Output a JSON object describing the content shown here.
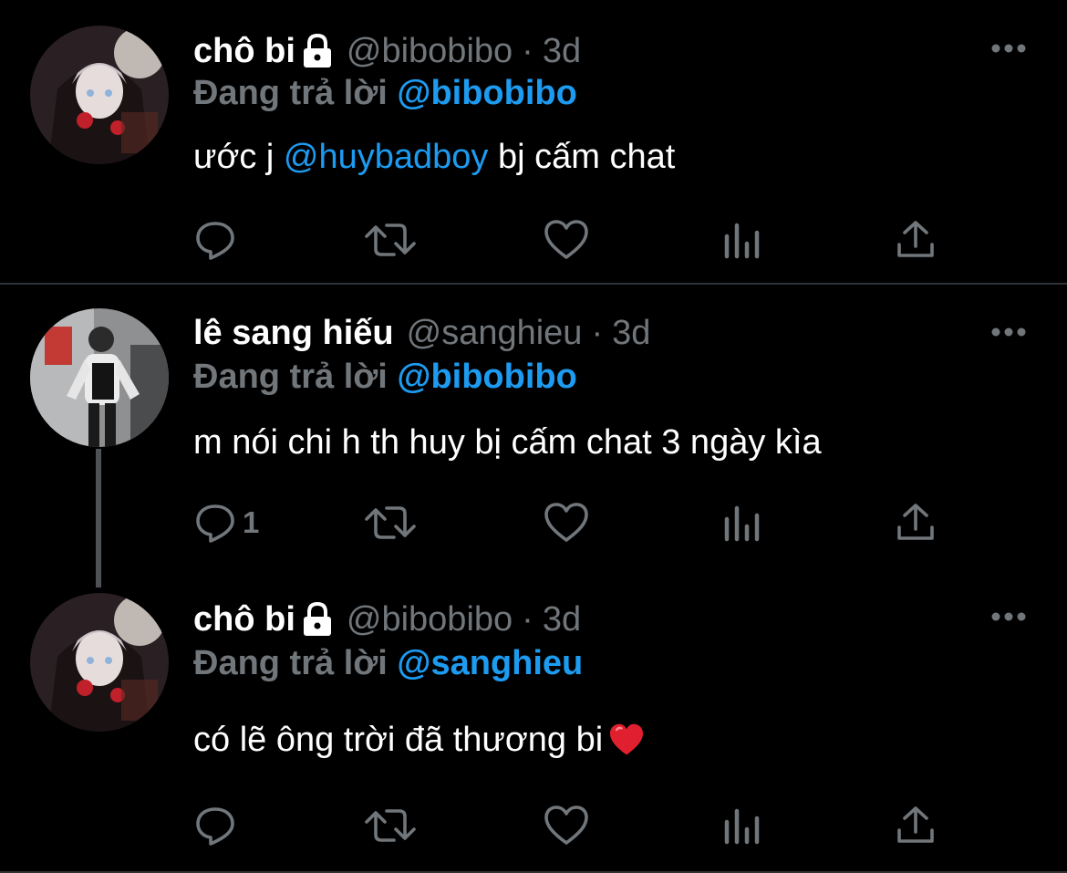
{
  "tweets": [
    {
      "display_name": "chô bi",
      "locked": true,
      "handle": "@bibobibo",
      "separator": "·",
      "time": "3d",
      "reply_prefix": "Đang trả lời",
      "reply_to": "@bibobibo",
      "text_before": "ước j ",
      "mention": "@huybadboy",
      "text_after": " bj cấm chat",
      "reply_count": ""
    },
    {
      "display_name": "lê sang hiếu",
      "locked": false,
      "handle": "@sanghieu",
      "separator": "·",
      "time": "3d",
      "reply_prefix": "Đang trả lời",
      "reply_to": "@bibobibo",
      "text": "m nói chi h th huy bị cấm chat 3 ngày kìa",
      "reply_count": "1"
    },
    {
      "display_name": "chô bi",
      "locked": true,
      "handle": "@bibobibo",
      "separator": "·",
      "time": "3d",
      "reply_prefix": "Đang trả lời",
      "reply_to": "@sanghieu",
      "text": "có lẽ ông trời đã thương bi",
      "emoji": "red-heart",
      "reply_count": ""
    }
  ],
  "icons": {
    "reply": "reply-icon",
    "retweet": "retweet-icon",
    "like": "like-icon",
    "views": "views-icon",
    "share": "share-icon",
    "more": "more-icon",
    "lock": "lock-icon"
  },
  "colors": {
    "background": "#000000",
    "name": "#ffffff",
    "secondary": "#71767b",
    "link": "#1d9bf0",
    "divider": "#2f3336"
  }
}
